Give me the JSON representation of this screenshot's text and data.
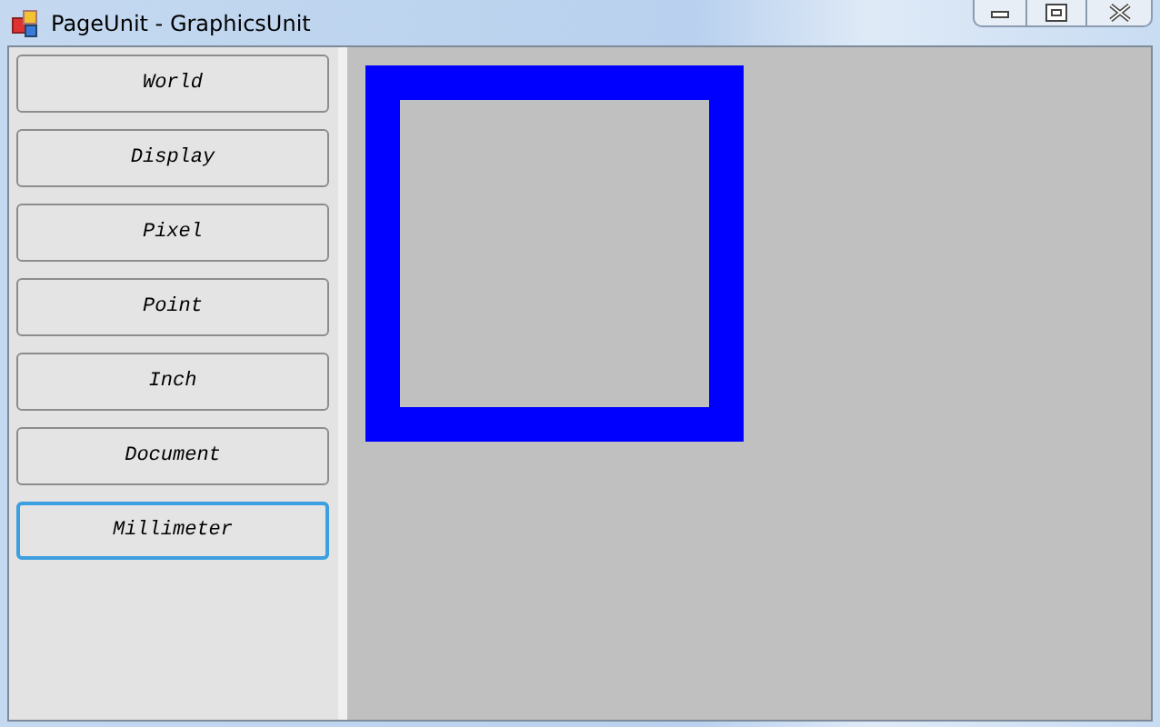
{
  "window": {
    "title": "PageUnit - GraphicsUnit"
  },
  "buttons": [
    {
      "label": "World",
      "selected": false
    },
    {
      "label": "Display",
      "selected": false
    },
    {
      "label": "Pixel",
      "selected": false
    },
    {
      "label": "Point",
      "selected": false
    },
    {
      "label": "Inch",
      "selected": false
    },
    {
      "label": "Document",
      "selected": false
    },
    {
      "label": "Millimeter",
      "selected": true
    }
  ]
}
